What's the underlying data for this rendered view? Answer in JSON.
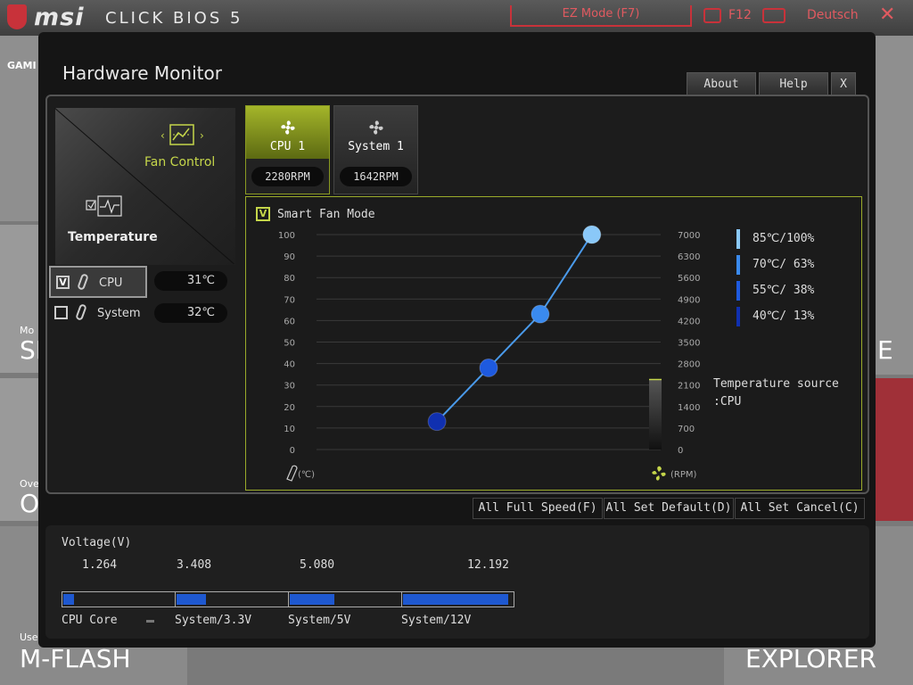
{
  "header": {
    "brand": "msi",
    "bios_name": "CLICK BIOS 5",
    "ez_mode": "EZ Mode (F7)",
    "screenshot_key": "F12",
    "language": "Deutsch",
    "close": "✕"
  },
  "background": {
    "game_label": "GAMI",
    "mo_label": "Mo",
    "si_label": "SI",
    "ov_label": "Ove",
    "o_label": "O",
    "use_label": "Use",
    "mflash": "M-FLASH",
    "explorer": "EXPLORER",
    "e_label": "E"
  },
  "dialog": {
    "title": "Hardware Monitor",
    "about": "About",
    "help": "Help",
    "close": "X"
  },
  "modes": {
    "fan_control": "Fan Control",
    "temperature": "Temperature"
  },
  "sensors": [
    {
      "name": "CPU",
      "value": "31℃",
      "checked": true,
      "check_mark": "V"
    },
    {
      "name": "System",
      "value": "32℃",
      "checked": false,
      "check_mark": ""
    }
  ],
  "fans": [
    {
      "name": "CPU 1",
      "rpm": "2280RPM"
    },
    {
      "name": "System 1",
      "rpm": "1642RPM"
    }
  ],
  "smart_fan": {
    "label": "Smart Fan Mode",
    "check_mark": "V"
  },
  "chart_data": {
    "type": "line",
    "x_label": "(℃)",
    "y_right_label": "(RPM)",
    "y_left_ticks": [
      "100",
      "90",
      "80",
      "70",
      "60",
      "50",
      "40",
      "30",
      "20",
      "10",
      "0"
    ],
    "y_right_ticks": [
      "7000",
      "6300",
      "5600",
      "4900",
      "4200",
      "3500",
      "2800",
      "2100",
      "1400",
      "700",
      "0"
    ],
    "points": [
      {
        "temp": 40,
        "percent": 13,
        "color": "#1030b0"
      },
      {
        "temp": 55,
        "percent": 38,
        "color": "#1e5adf"
      },
      {
        "temp": 70,
        "percent": 63,
        "color": "#3a8aee"
      },
      {
        "temp": 85,
        "percent": 100,
        "color": "#8ac8f8"
      }
    ],
    "current_rpm_gauge": 2280
  },
  "legend": [
    {
      "text": "85℃/100%",
      "color": "#8ac8f8"
    },
    {
      "text": "70℃/ 63%",
      "color": "#3a8aee"
    },
    {
      "text": "55℃/ 38%",
      "color": "#1e5adf"
    },
    {
      "text": "40℃/ 13%",
      "color": "#1030b0"
    }
  ],
  "temp_source": {
    "line1": "Temperature source",
    "line2": ":CPU"
  },
  "actions": {
    "full_speed": "All Full Speed(F)",
    "set_default": "All Set Default(D)",
    "set_cancel": "All Set Cancel(C)"
  },
  "voltage": {
    "title": "Voltage(V)",
    "rails": [
      {
        "name": "CPU Core",
        "value": "1.264",
        "level": 0.1
      },
      {
        "name": "System/3.3V",
        "value": "3.408",
        "level": 0.28
      },
      {
        "name": "System/5V",
        "value": "5.080",
        "level": 0.42
      },
      {
        "name": "System/12V",
        "value": "12.192",
        "level": 1.0
      }
    ]
  }
}
